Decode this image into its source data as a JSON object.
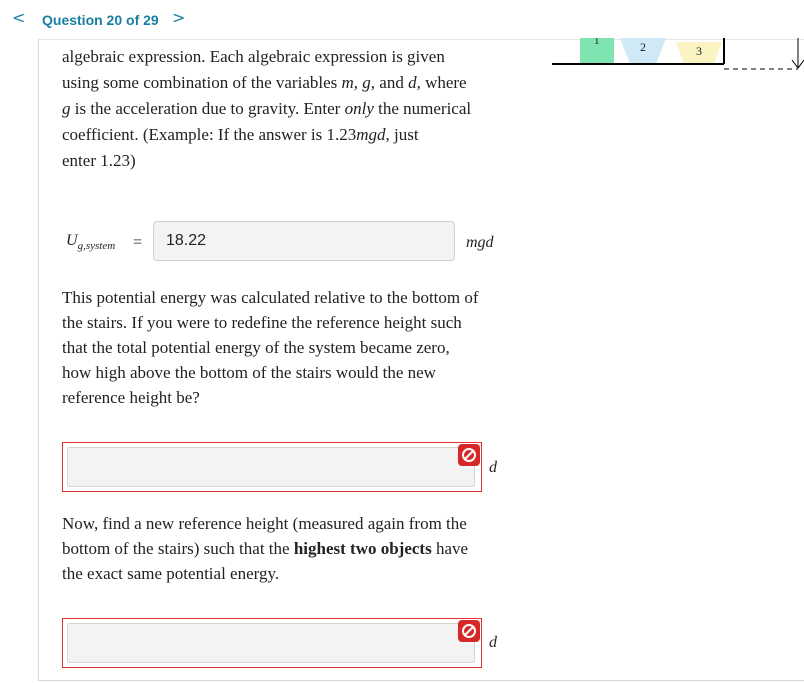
{
  "header": {
    "prev_arrow": "<",
    "title": "Question 20 of 29",
    "next_arrow": ">"
  },
  "diagram": {
    "labels": [
      "1",
      "2",
      "3"
    ],
    "colors": {
      "box1": "#7fe3b0",
      "box2": "#cfe9f7",
      "box3": "#fbf3c2"
    }
  },
  "intro": {
    "line1": "algebraic expression. Each algebraic expression is given",
    "line2_a": "using some combination of the variables ",
    "line2_vars": "m, g,",
    "line2_b": " and ",
    "line2_var_d": "d",
    "line2_c": ", where",
    "line3_var_g": "g",
    "line3_a": " is the acceleration due to gravity. Enter ",
    "line3_only": "only",
    "line3_b": " the numerical",
    "line4_a": "coefficient. (Example: If the answer is 1.23",
    "line4_var": "mgd",
    "line4_b": ", just",
    "line5": "enter 1.23)"
  },
  "answer1": {
    "label_main": "U",
    "label_sub": "g,system",
    "equals": "=",
    "value": "18.22",
    "unit": "mgd"
  },
  "question2": {
    "lines": [
      "This potential energy was calculated relative to the bottom of",
      "the stairs. If you were to redefine the reference height such",
      "that the total potential energy of the system became zero,",
      "how high above the bottom of the stairs would the new",
      "reference height be?"
    ],
    "unit": "d"
  },
  "question3": {
    "line1": "Now, find a new reference height (measured again from the",
    "line2_a": "bottom of the stairs) such that the ",
    "line2_bold": "highest two objects",
    "line2_b": " have",
    "line3": "the exact same potential energy.",
    "unit": "d"
  },
  "colors": {
    "accent": "#1a7ea3",
    "error": "#d62828"
  }
}
